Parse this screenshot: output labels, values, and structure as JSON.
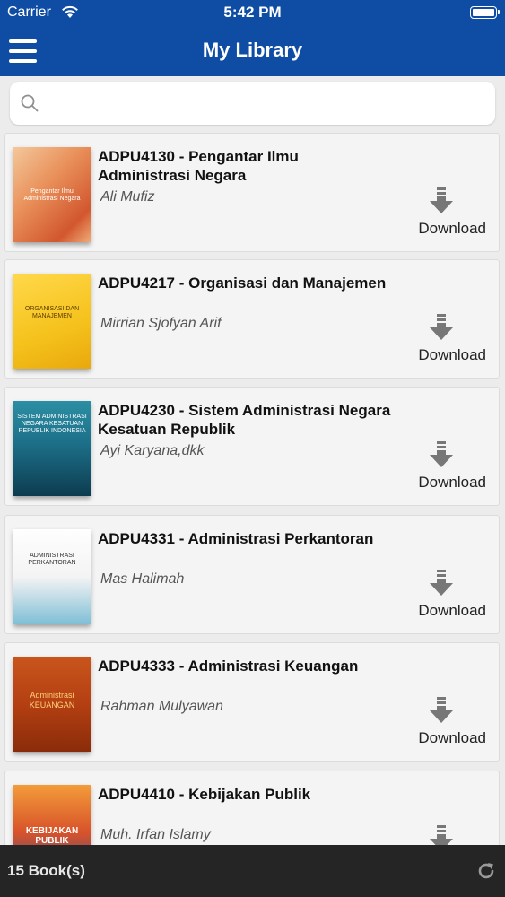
{
  "status_bar": {
    "carrier": "Carrier",
    "time": "5:42 PM",
    "battery_level": 1.0
  },
  "nav": {
    "title": "My Library",
    "menu_icon": "hamburger-menu-icon"
  },
  "search": {
    "placeholder": "",
    "value": "",
    "icon": "search-icon"
  },
  "download_label": "Download",
  "books": [
    {
      "title": "ADPU4130 - Pengantar Ilmu Administrasi Negara",
      "author": "Ali Mufiz",
      "cover_color": "#e9915b"
    },
    {
      "title": "ADPU4217 - Organisasi dan Manajemen",
      "author": "Mirrian Sjofyan Arif",
      "cover_color": "#f5c21c"
    },
    {
      "title": "ADPU4230 - Sistem Administrasi Negara Kesatuan Republik",
      "author": "Ayi Karyana,dkk",
      "cover_color": "#1c6f88"
    },
    {
      "title": "ADPU4331 - Administrasi Perkantoran",
      "author": "Mas Halimah",
      "cover_color": "#7fbfd6"
    },
    {
      "title": "ADPU4333 - Administrasi Keuangan",
      "author": "Rahman Mulyawan",
      "cover_color": "#b43f12"
    },
    {
      "title": "ADPU4410 - Kebijakan Publik",
      "author": "Muh. Irfan Islamy",
      "cover_color": "#d8522a"
    }
  ],
  "cover_texts": {
    "b1": "Pengantar Ilmu Administrasi Negara",
    "b2": "ORGANISASI DAN MANAJEMEN",
    "b3": "SISTEM ADMINISTRASI NEGARA KESATUAN REPUBLIK INDONESIA",
    "b4": "ADMINISTRASI PERKANTORAN",
    "b5": "Administrasi KEUANGAN",
    "b6": "KEBIJAKAN PUBLIK"
  },
  "footer": {
    "count_label": "15 Book(s)",
    "refresh_icon": "refresh-icon"
  },
  "colors": {
    "primary": "#0f4da5",
    "footer": "#252525",
    "background": "#ececec"
  }
}
